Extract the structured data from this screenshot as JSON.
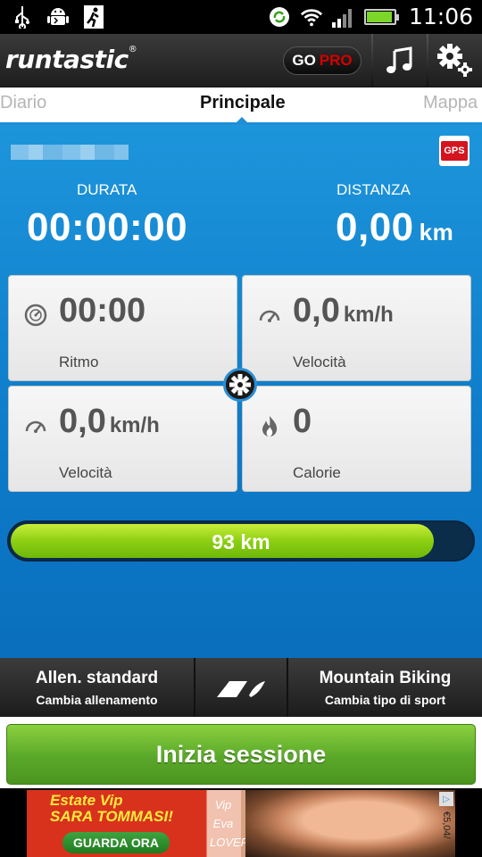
{
  "status_bar": {
    "time": "11:06",
    "icons": [
      "usb-icon",
      "android-debug-icon",
      "runner-notification-icon",
      "sync-icon",
      "wifi-icon",
      "signal-icon",
      "battery-icon"
    ]
  },
  "app_bar": {
    "logo": "runtastic",
    "logo_mark": "®",
    "gopro_go": "GO",
    "gopro_pro": "PRO",
    "icons": [
      "music-note-icon",
      "settings-gear-icon"
    ]
  },
  "tabs": {
    "left": "Diario",
    "active": "Principale",
    "right": "Mappa"
  },
  "main": {
    "gps_badge": "GPS",
    "duration_label": "DURATA",
    "duration_value": "00:00:00",
    "distance_label": "DISTANZA",
    "distance_value": "0,00",
    "distance_unit": "km"
  },
  "tiles": [
    {
      "icon": "stopwatch-icon",
      "value": "00:00",
      "unit": "",
      "label": "Ritmo"
    },
    {
      "icon": "speedometer-icon",
      "value": "0,0",
      "unit": "km/h",
      "label": "Velocità"
    },
    {
      "icon": "speedometer-icon",
      "value": "0,0",
      "unit": "km/h",
      "label": "Velocità"
    },
    {
      "icon": "flame-icon",
      "value": "0",
      "unit": "",
      "label": "Calorie"
    }
  ],
  "progress": {
    "text": "93 km",
    "fraction": 0.92
  },
  "controls": {
    "workout_title": "Allen. standard",
    "workout_sub": "Cambia allenamento",
    "sport_title": "Mountain Biking",
    "sport_sub": "Cambia tipo di sport",
    "center_icon": "shoe-sport-icon"
  },
  "start_button": "Inizia sessione",
  "ad": {
    "line1": "Estate Vip",
    "line2": "SARA TOMMASI!",
    "button": "GUARDA ORA",
    "mag_lines": [
      "Vip",
      "Eva",
      "LOVER"
    ],
    "price": "€5,04/",
    "badge": "▷"
  },
  "colors": {
    "accent_blue": "#1d95db",
    "progress_green": "#8ccf12",
    "start_green": "#5aa82a",
    "gps_red": "#d4141e",
    "pro_red": "#d40000"
  }
}
